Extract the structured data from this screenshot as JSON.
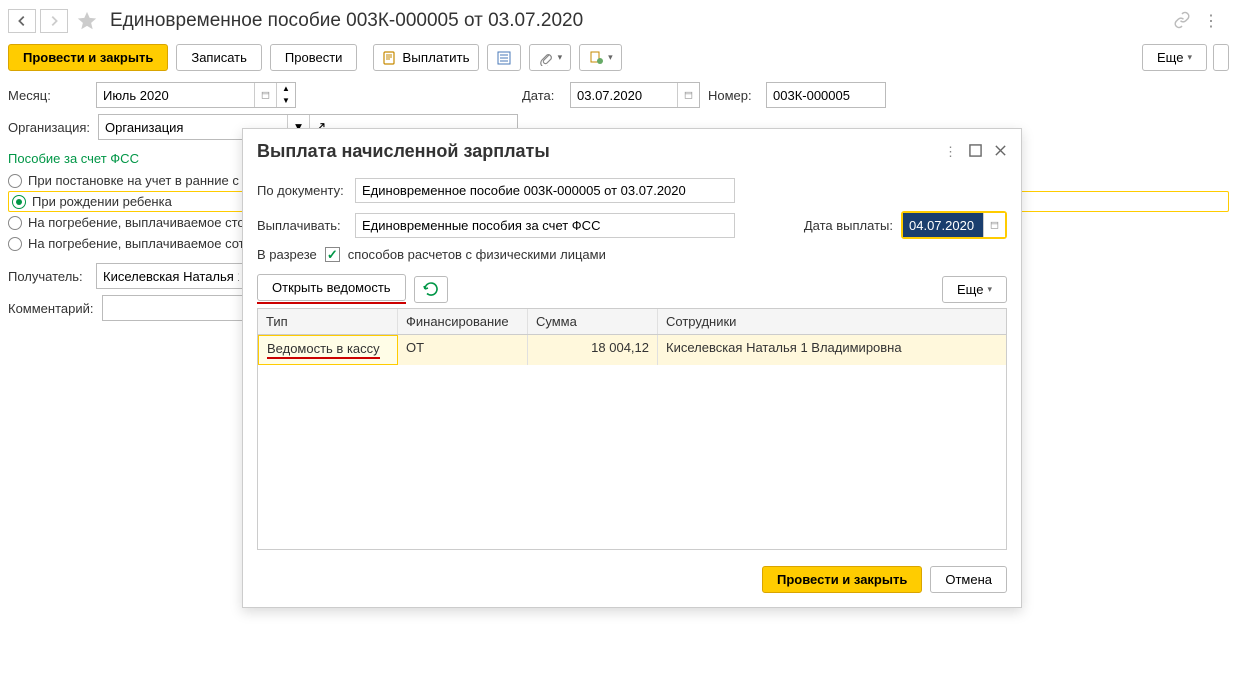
{
  "header": {
    "title": "Единовременное пособие 003К-000005 от 03.07.2020"
  },
  "toolbar": {
    "post_close": "Провести и закрыть",
    "save": "Записать",
    "post": "Провести",
    "pay": "Выплатить",
    "more": "Еще"
  },
  "fields": {
    "month_label": "Месяц:",
    "month_value": "Июль 2020",
    "date_label": "Дата:",
    "date_value": "03.07.2020",
    "number_label": "Номер:",
    "number_value": "003К-000005",
    "org_label": "Организация:",
    "org_value": "Организация",
    "recipient_label": "Получатель:",
    "recipient_value": "Киселевская Наталья 1",
    "comment_label": "Комментарий:",
    "comment_value": ""
  },
  "radio_section": {
    "title": "Пособие за счет ФСС",
    "opt1": "При постановке на учет в ранние с",
    "opt2": "При рождении ребенка",
    "opt3": "На погребение, выплачиваемое сто",
    "opt4": "На погребение, выплачиваемое сот"
  },
  "dialog": {
    "title": "Выплата начисленной зарплаты",
    "doc_label": "По документу:",
    "doc_value": "Единовременное пособие 003К-000005 от 03.07.2020",
    "pay_label": "Выплачивать:",
    "pay_value": "Единовременные пособия за счет ФСС",
    "paydate_label": "Дата выплаты:",
    "paydate_value": "04.07.2020",
    "slice_label": "В разрезе",
    "slice_text": "способов расчетов с физическими лицами",
    "open_btn": "Открыть ведомость",
    "more": "Еще",
    "columns": {
      "type": "Тип",
      "fin": "Финансирование",
      "sum": "Сумма",
      "emp": "Сотрудники"
    },
    "row": {
      "type": "Ведомость в кассу",
      "fin": "ОТ",
      "sum": "18 004,12",
      "emp": "Киселевская Наталья 1 Владимировна"
    },
    "footer_ok": "Провести и закрыть",
    "footer_cancel": "Отмена"
  }
}
